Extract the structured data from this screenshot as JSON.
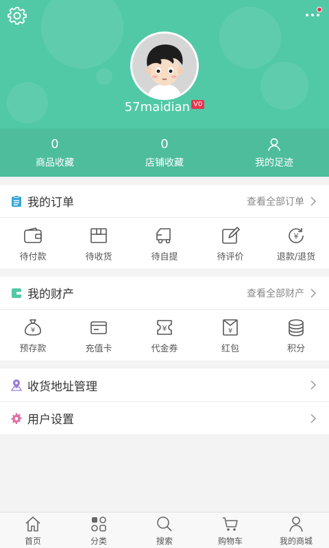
{
  "colors": {
    "primary": "#52c9a6",
    "badge": "#e8344e",
    "orders_icon": "#3aa7d6",
    "assets_icon": "#52c9a6",
    "address_icon": "#9b7fd6",
    "settings_icon": "#e06fa6"
  },
  "header": {
    "settings_icon": "gear-icon",
    "more_icon": "more-dots-icon",
    "username": "57maidian",
    "vip_level": "V0",
    "stats": [
      {
        "value": "0",
        "label": "商品收藏"
      },
      {
        "value": "0",
        "label": "店铺收藏"
      },
      {
        "icon": "person-icon",
        "label": "我的足迹"
      }
    ]
  },
  "orders": {
    "title": "我的订单",
    "link": "查看全部订单",
    "items": [
      {
        "label": "待付款",
        "icon": "wallet-icon"
      },
      {
        "label": "待收货",
        "icon": "box-icon"
      },
      {
        "label": "待自提",
        "icon": "truck-icon"
      },
      {
        "label": "待评价",
        "icon": "edit-icon"
      },
      {
        "label": "退款/退货",
        "icon": "refund-icon"
      }
    ]
  },
  "assets": {
    "title": "我的财产",
    "link": "查看全部财产",
    "items": [
      {
        "label": "预存款",
        "icon": "money-bag-icon"
      },
      {
        "label": "充值卡",
        "icon": "card-icon"
      },
      {
        "label": "代金券",
        "icon": "voucher-icon"
      },
      {
        "label": "红包",
        "icon": "red-envelope-icon"
      },
      {
        "label": "积分",
        "icon": "coins-icon"
      }
    ]
  },
  "menu": [
    {
      "label": "收货地址管理",
      "icon": "location-icon"
    },
    {
      "label": "用户设置",
      "icon": "gear-icon"
    }
  ],
  "nav": [
    {
      "label": "首页",
      "icon": "home-icon"
    },
    {
      "label": "分类",
      "icon": "category-icon"
    },
    {
      "label": "搜索",
      "icon": "search-icon"
    },
    {
      "label": "购物车",
      "icon": "cart-icon"
    },
    {
      "label": "我的商城",
      "icon": "user-icon"
    }
  ]
}
